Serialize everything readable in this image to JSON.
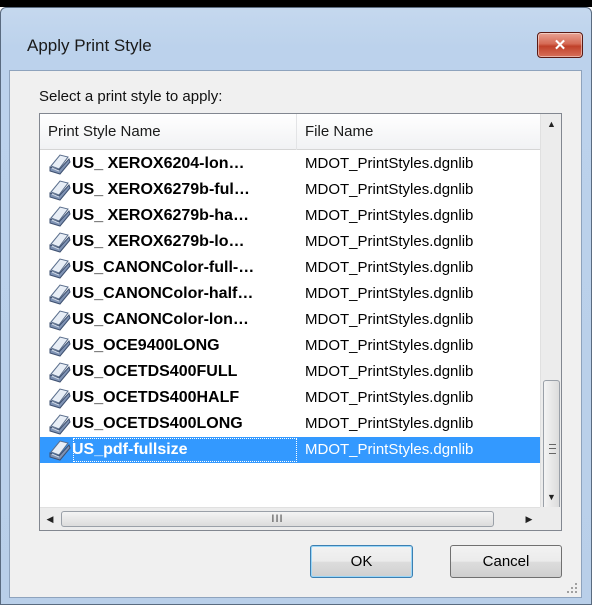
{
  "dialog": {
    "title": "Apply Print Style",
    "close_label": "✕"
  },
  "prompt": "Select a print style to apply:",
  "columns": [
    "Print Style Name",
    "File Name"
  ],
  "rows": [
    {
      "name": "US_ XEROX6204-lon…",
      "file": "MDOT_PrintStyles.dgnlib",
      "selected": false
    },
    {
      "name": "US_ XEROX6279b-ful…",
      "file": "MDOT_PrintStyles.dgnlib",
      "selected": false
    },
    {
      "name": "US_ XEROX6279b-ha…",
      "file": "MDOT_PrintStyles.dgnlib",
      "selected": false
    },
    {
      "name": "US_ XEROX6279b-lo…",
      "file": "MDOT_PrintStyles.dgnlib",
      "selected": false
    },
    {
      "name": "US_CANONColor-full-…",
      "file": "MDOT_PrintStyles.dgnlib",
      "selected": false
    },
    {
      "name": "US_CANONColor-half…",
      "file": "MDOT_PrintStyles.dgnlib",
      "selected": false
    },
    {
      "name": "US_CANONColor-lon…",
      "file": "MDOT_PrintStyles.dgnlib",
      "selected": false
    },
    {
      "name": "US_OCE9400LONG",
      "file": "MDOT_PrintStyles.dgnlib",
      "selected": false
    },
    {
      "name": "US_OCETDS400FULL",
      "file": "MDOT_PrintStyles.dgnlib",
      "selected": false
    },
    {
      "name": "US_OCETDS400HALF",
      "file": "MDOT_PrintStyles.dgnlib",
      "selected": false
    },
    {
      "name": "US_OCETDS400LONG",
      "file": "MDOT_PrintStyles.dgnlib",
      "selected": false
    },
    {
      "name": "US_pdf-fullsize",
      "file": "MDOT_PrintStyles.dgnlib",
      "selected": true
    }
  ],
  "buttons": {
    "ok": "OK",
    "cancel": "Cancel"
  },
  "icons": {
    "row_icon": "print-style-icon",
    "scroll_up": "▲",
    "scroll_down": "▼",
    "scroll_left": "◀",
    "scroll_right": "▶",
    "h_grip": "III"
  },
  "colors": {
    "selection": "#3399ff",
    "close_button": "#c94a33"
  }
}
